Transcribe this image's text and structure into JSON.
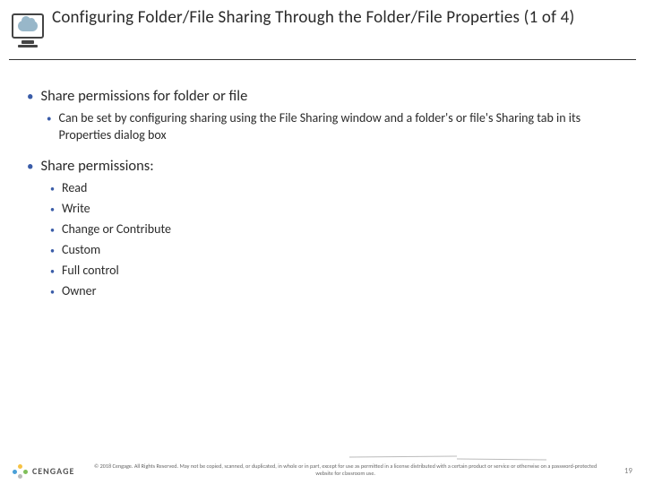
{
  "header": {
    "title": "Configuring Folder/File Sharing Through the Folder/File Properties (1 of 4)"
  },
  "body": {
    "items": [
      {
        "text": "Share permissions for folder or file",
        "sub": [
          {
            "text": "Can be set by configuring sharing using the File Sharing window and a folder's or file's Sharing tab in its Properties dialog box"
          }
        ]
      },
      {
        "text": "Share permissions:",
        "perms": [
          {
            "text": "Read"
          },
          {
            "text": "Write"
          },
          {
            "text": "Change or Contribute"
          },
          {
            "text": "Custom"
          },
          {
            "text": "Full control"
          },
          {
            "text": "Owner"
          }
        ]
      }
    ]
  },
  "footer": {
    "brand": "CENGAGE",
    "copyright": "© 2018 Cengage. All Rights Reserved. May not be copied, scanned, or duplicated, in whole or in part, except for use as permitted in a license distributed with a certain product or service or otherwise on a password-protected website for classroom use.",
    "page": "19"
  }
}
